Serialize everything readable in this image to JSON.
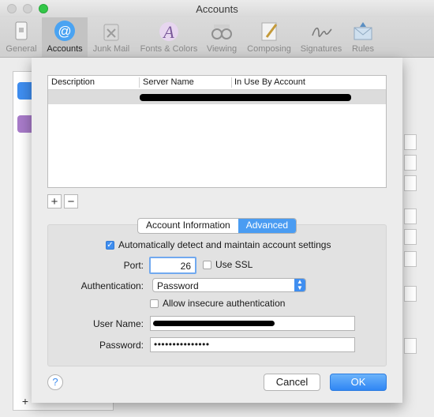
{
  "window": {
    "title": "Accounts"
  },
  "toolbar": {
    "items": [
      {
        "label": "General",
        "icon": "general-icon"
      },
      {
        "label": "Accounts",
        "icon": "accounts-icon",
        "active": true
      },
      {
        "label": "Junk Mail",
        "icon": "junk-mail-icon"
      },
      {
        "label": "Fonts & Colors",
        "icon": "fonts-colors-icon"
      },
      {
        "label": "Viewing",
        "icon": "viewing-icon"
      },
      {
        "label": "Composing",
        "icon": "composing-icon"
      },
      {
        "label": "Signatures",
        "icon": "signatures-icon"
      },
      {
        "label": "Rules",
        "icon": "rules-icon"
      }
    ]
  },
  "server_table": {
    "columns": [
      "Description",
      "Server Name",
      "In Use By Account"
    ],
    "rows": [
      {
        "description": "",
        "server_name": "[redacted]",
        "in_use_by": ""
      }
    ]
  },
  "list_controls": {
    "add": "+",
    "remove": "−"
  },
  "tabs": {
    "account_info": "Account Information",
    "advanced": "Advanced",
    "selected": "Advanced"
  },
  "settings": {
    "auto_detect_label": "Automatically detect and maintain account settings",
    "auto_detect_checked": true,
    "port_label": "Port:",
    "port_value": "26",
    "ssl_label": "Use SSL",
    "ssl_checked": false,
    "auth_label": "Authentication:",
    "auth_value": "Password",
    "insecure_label": "Allow insecure authentication",
    "insecure_checked": false,
    "username_label": "User Name:",
    "username_value": "[redacted]",
    "password_label": "Password:",
    "password_value": "•••••••••••••••"
  },
  "buttons": {
    "help": "?",
    "cancel": "Cancel",
    "ok": "OK"
  },
  "colors": {
    "accent": "#3f8ef0",
    "selected_tab": "#4a9cf2"
  }
}
